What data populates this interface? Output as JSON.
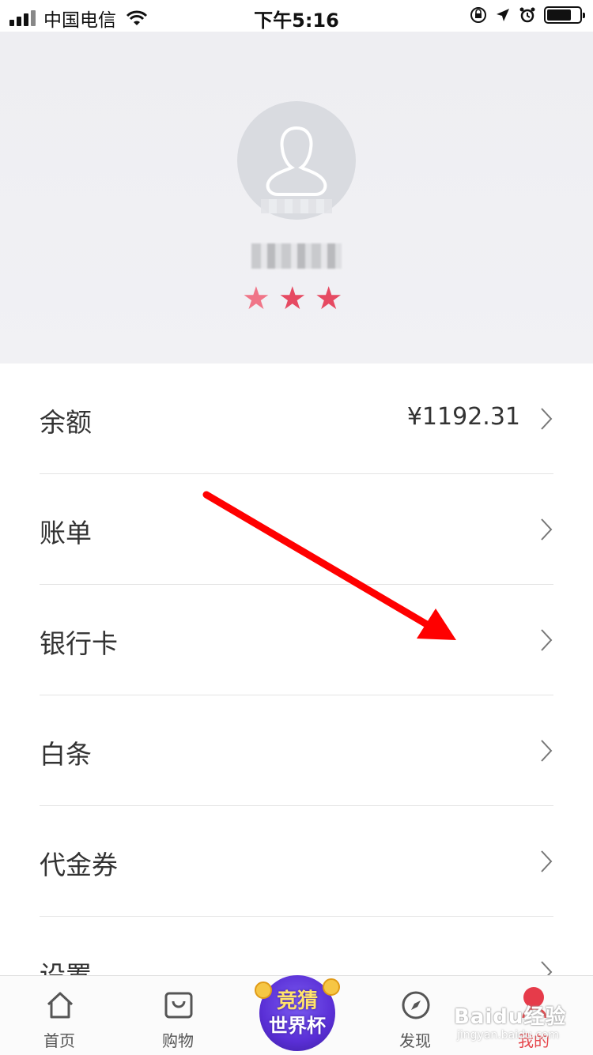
{
  "status_bar": {
    "carrier": "中国电信",
    "time": "下午5:16"
  },
  "profile": {
    "rating_stars": 3
  },
  "menu": [
    {
      "label": "余额",
      "value": "¥1192.31"
    },
    {
      "label": "账单",
      "value": ""
    },
    {
      "label": "银行卡",
      "value": ""
    },
    {
      "label": "白条",
      "value": ""
    },
    {
      "label": "代金券",
      "value": ""
    },
    {
      "label": "设置",
      "value": ""
    }
  ],
  "tabbar": {
    "home": "首页",
    "shopping": "购物",
    "promo_line1": "竞猜",
    "promo_line2": "世界杯",
    "discover": "发现",
    "mine": "我的"
  },
  "watermark": {
    "text": "Baidu经验",
    "url": "jingyan.baidu.com"
  },
  "colors": {
    "accent": "#e5454a",
    "annotation_arrow": "#ff0000",
    "star": "#e64a62"
  }
}
